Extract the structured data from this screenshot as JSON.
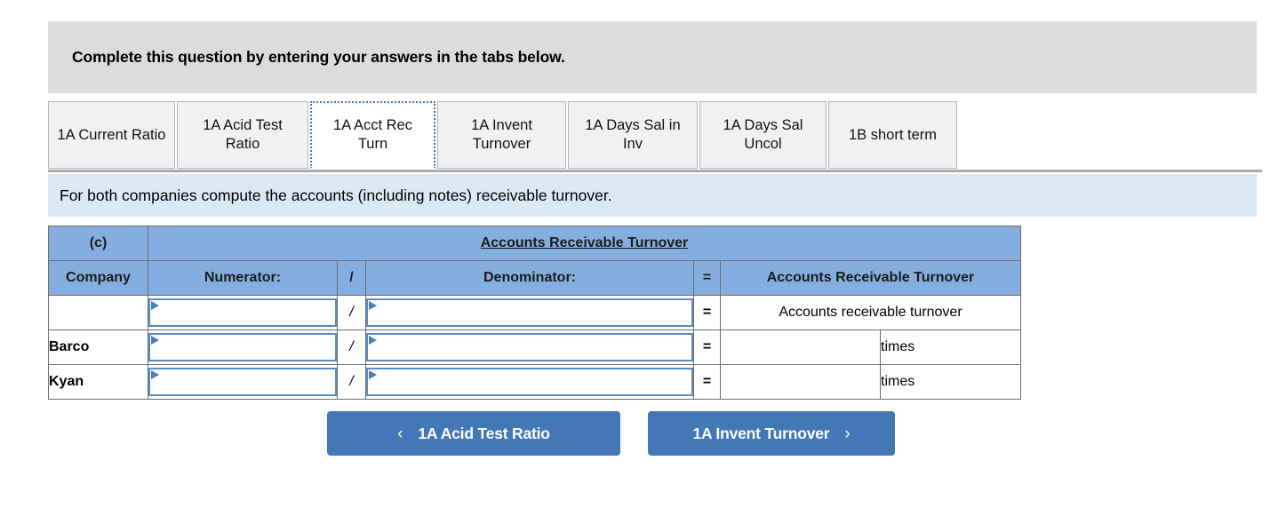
{
  "banner": {
    "text": "Complete this question by entering your answers in the tabs below."
  },
  "tabs": [
    {
      "label": "1A Current Ratio",
      "active": false
    },
    {
      "label": "1A Acid Test Ratio",
      "active": false
    },
    {
      "label": "1A Acct Rec Turn",
      "active": true
    },
    {
      "label": "1A Invent Turnover",
      "active": false
    },
    {
      "label": "1A Days Sal in Inv",
      "active": false
    },
    {
      "label": "1A Days Sal Uncol",
      "active": false
    },
    {
      "label": "1B short term",
      "active": false
    }
  ],
  "prompt": {
    "text": "For both companies compute the accounts (including notes) receivable turnover."
  },
  "table": {
    "part_label": "(c)",
    "title": "Accounts Receivable Turnover",
    "columns": {
      "company": "Company",
      "numerator": "Numerator:",
      "slash": "/",
      "denominator": "Denominator:",
      "equals": "=",
      "result": "Accounts Receivable Turnover"
    },
    "rows": [
      {
        "company": "",
        "numerator_value": "",
        "numerator_placeholder": "",
        "slash": "/",
        "denominator_value": "",
        "denominator_placeholder": "",
        "equals": "=",
        "result_label": "Accounts receivable turnover",
        "result_value": "",
        "units": ""
      },
      {
        "company": "Barco",
        "numerator_value": "",
        "numerator_placeholder": "",
        "slash": "/",
        "denominator_value": "",
        "denominator_placeholder": "",
        "equals": "=",
        "result_label": "",
        "result_value": "",
        "units": "times"
      },
      {
        "company": "Kyan",
        "numerator_value": "",
        "numerator_placeholder": "",
        "slash": "/",
        "denominator_value": "",
        "denominator_placeholder": "",
        "equals": "=",
        "result_label": "",
        "result_value": "",
        "units": "times"
      }
    ]
  },
  "nav": {
    "prev_label": "1A Acid Test Ratio",
    "prev_icon": "chevron-left",
    "prev_glyph": "‹",
    "next_label": "1A Invent Turnover",
    "next_icon": "chevron-right",
    "next_glyph": "›"
  },
  "colors": {
    "banner_bg": "#dcdcdc",
    "prompt_bg": "#dbe9f7",
    "table_header_bg": "#85aee0",
    "button_bg": "#4377b5",
    "field_border": "#5b8bc4",
    "tab_bg": "#f1f1f1",
    "active_tab_border": "#3f78b5"
  }
}
